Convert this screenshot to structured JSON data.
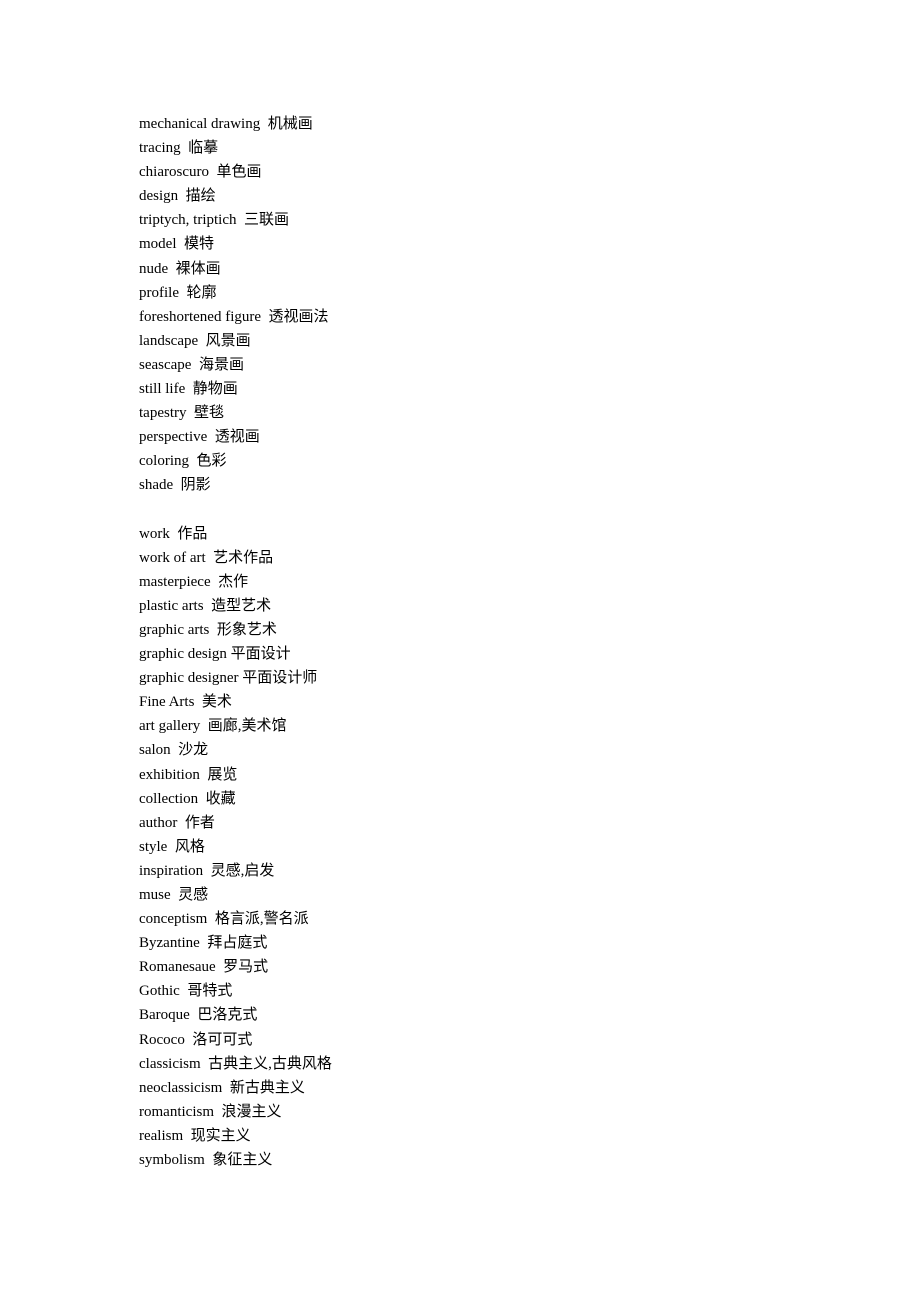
{
  "groups": [
    [
      "mechanical drawing  机械画",
      "tracing  临摹",
      "chiaroscuro  单色画",
      "design  描绘",
      "triptych, triptich  三联画",
      "model  模特",
      "nude  裸体画",
      "profile  轮廓",
      "foreshortened figure  透视画法",
      "landscape  风景画",
      "seascape  海景画",
      "still life  静物画",
      "tapestry  壁毯",
      "perspective  透视画",
      "coloring  色彩",
      "shade  阴影"
    ],
    [
      "work  作品",
      "work of art  艺术作品",
      "masterpiece  杰作",
      "plastic arts  造型艺术",
      "graphic arts  形象艺术",
      "graphic design 平面设计",
      "graphic designer 平面设计师",
      "Fine Arts  美术",
      "art gallery  画廊,美术馆",
      "salon  沙龙",
      "exhibition  展览",
      "collection  收藏",
      "author  作者",
      "style  风格",
      "inspiration  灵感,启发",
      "muse  灵感",
      "conceptism  格言派,警名派",
      "Byzantine  拜占庭式",
      "Romanesaue  罗马式",
      "Gothic  哥特式",
      "Baroque  巴洛克式",
      "Rococo  洛可可式",
      "classicism  古典主义,古典风格",
      "neoclassicism  新古典主义",
      "romanticism  浪漫主义",
      "realism  现实主义",
      "symbolism  象征主义"
    ]
  ]
}
